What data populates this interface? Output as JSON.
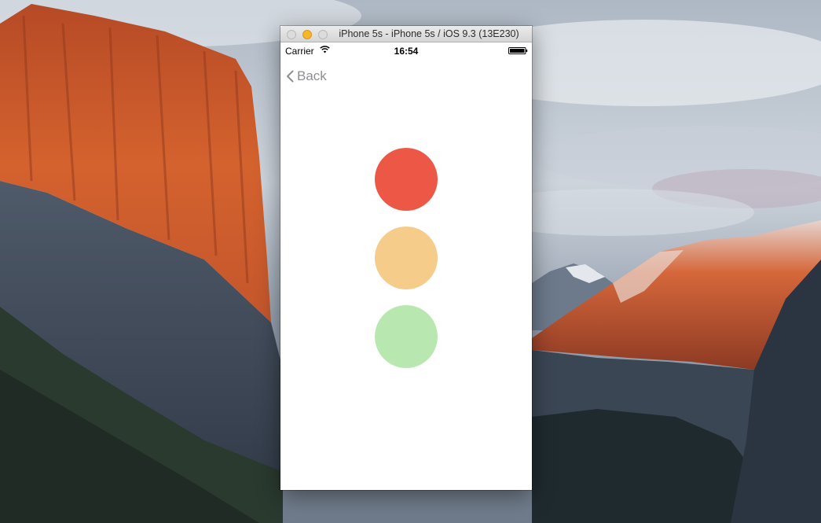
{
  "window": {
    "title": "iPhone 5s - iPhone 5s / iOS 9.3 (13E230)"
  },
  "status_bar": {
    "carrier": "Carrier",
    "time": "16:54",
    "icons": [
      "wifi-icon",
      "battery-icon"
    ]
  },
  "nav_bar": {
    "back_label": "Back",
    "back_icon": "chevron-left-icon"
  },
  "traffic_lights": [
    {
      "name": "red-light",
      "color": "#ec5845"
    },
    {
      "name": "yellow-light",
      "color": "#f6cc8a"
    },
    {
      "name": "green-light",
      "color": "#b8e8b0"
    }
  ],
  "colors": {
    "nav_tint": "#8e8e93",
    "window_min_button": "#f5b629"
  }
}
